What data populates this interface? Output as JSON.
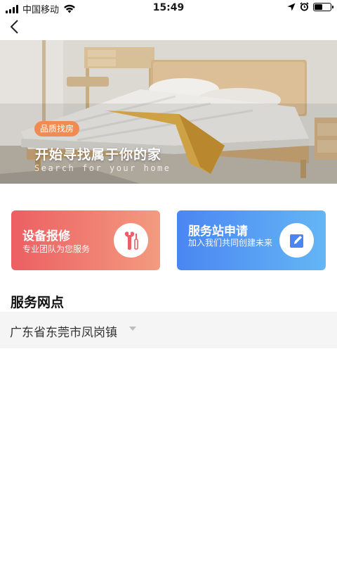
{
  "status_bar": {
    "carrier": "中国移动",
    "time": "15:49",
    "battery_level": 0.55
  },
  "nav": {
    "back_icon": "chevron-left-icon"
  },
  "banner": {
    "tag": "品质找房",
    "title": "开始寻找属于你的家",
    "subtitle": "Search for your home",
    "colors": {
      "tag_bg": "#f08c53"
    }
  },
  "cards": {
    "repair": {
      "title": "设备报修",
      "desc": "专业团队为您服务",
      "icon": "wrench-screwdriver-icon",
      "colors": {
        "start": "#ec5f63",
        "end": "#f39b7f"
      }
    },
    "apply": {
      "title": "服务站申请",
      "desc": "加入我们共同创建未来",
      "icon": "edit-icon",
      "colors": {
        "start": "#4a86f2",
        "end": "#64b6f5"
      }
    }
  },
  "service_points": {
    "title": "服务网点",
    "location": "广东省东莞市凤岗镇",
    "dropdown_icon": "caret-down-icon"
  }
}
